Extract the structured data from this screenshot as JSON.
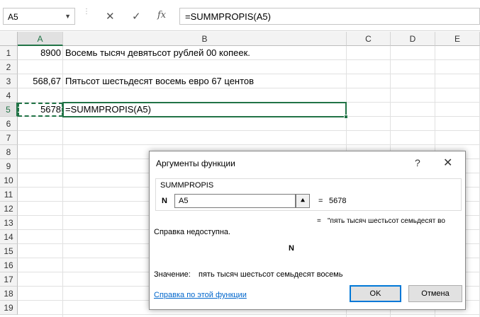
{
  "formula_bar": {
    "name_box": "A5",
    "cancel_icon": "✕",
    "enter_icon": "✓",
    "fx_icon": "fx",
    "formula": "=SUMMPROPIS(A5)"
  },
  "columns": [
    "A",
    "B",
    "C",
    "D",
    "E"
  ],
  "rows": [
    "1",
    "2",
    "3",
    "4",
    "5",
    "6",
    "7",
    "8",
    "9",
    "10",
    "11",
    "12",
    "13",
    "14",
    "15",
    "16",
    "17",
    "18",
    "19"
  ],
  "cells": {
    "a1": "8900",
    "b1": "Восемь тысяч девятьсот рублей  00 копеек.",
    "a3": "568,67",
    "b3": "Пятьсот шестьдесят восемь евро 67 центов",
    "a5": "5678",
    "b5": "=SUMMPROPIS(A5)"
  },
  "dialog": {
    "title": "Аргументы функции",
    "help_icon": "?",
    "close_icon": "✕",
    "function_name": "SUMMPROPIS",
    "arg_label": "N",
    "arg_value": "A5",
    "arg_button_icon": "⯅",
    "arg_equals": "=",
    "arg_result": "5678",
    "result_equals": "=",
    "result_preview": "\"пять тысяч шестьсот семьдесят во",
    "no_help": "Справка недоступна.",
    "param_name": "N",
    "value_label": "Значение:",
    "value_text": "пять тысяч шестьсот семьдесят восемь",
    "help_link": "Справка по этой функции",
    "ok": "OK",
    "cancel": "Отмена"
  },
  "colors": {
    "accent": "#217346",
    "link": "#0066cc",
    "focus": "#0078d7"
  }
}
